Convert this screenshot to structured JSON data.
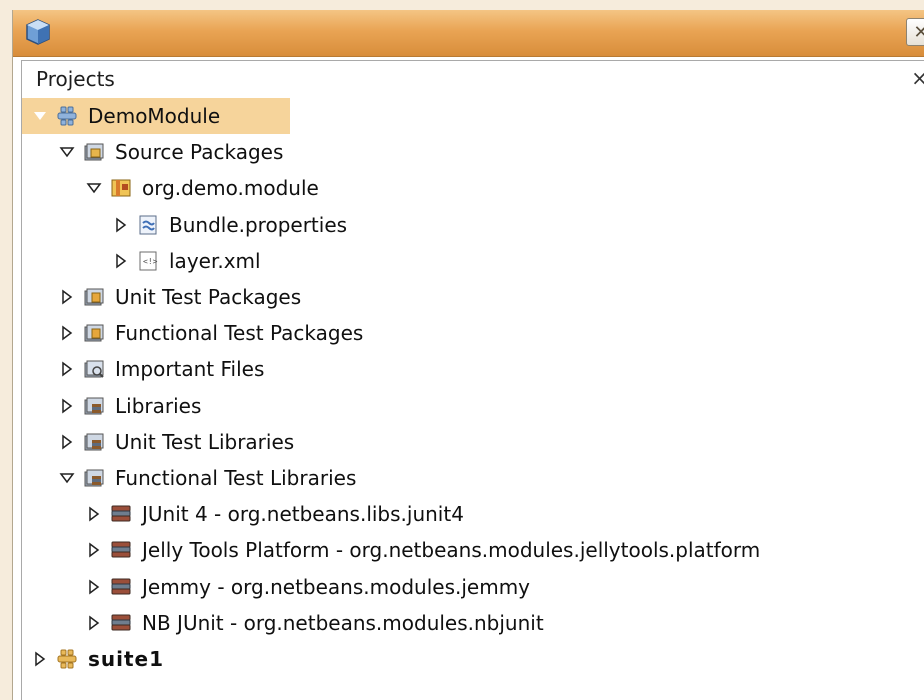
{
  "window": {
    "close_glyph": "✕"
  },
  "panel": {
    "title": "Projects",
    "close_glyph": "×"
  },
  "tree": [
    {
      "label": "DemoModule",
      "level": 0,
      "state": "expanded",
      "icon": "module-icon",
      "selected": true,
      "bold": false
    },
    {
      "label": "Source Packages",
      "level": 1,
      "state": "expanded",
      "icon": "source-packages-icon",
      "selected": false,
      "bold": false
    },
    {
      "label": "org.demo.module",
      "level": 2,
      "state": "expanded",
      "icon": "package-icon",
      "selected": false,
      "bold": false
    },
    {
      "label": "Bundle.properties",
      "level": 3,
      "state": "collapsed",
      "icon": "properties-file-icon",
      "selected": false,
      "bold": false
    },
    {
      "label": "layer.xml",
      "level": 3,
      "state": "collapsed",
      "icon": "xml-file-icon",
      "selected": false,
      "bold": false
    },
    {
      "label": "Unit Test Packages",
      "level": 1,
      "state": "collapsed",
      "icon": "test-packages-icon",
      "selected": false,
      "bold": false
    },
    {
      "label": "Functional Test Packages",
      "level": 1,
      "state": "collapsed",
      "icon": "test-packages-icon",
      "selected": false,
      "bold": false
    },
    {
      "label": "Important Files",
      "level": 1,
      "state": "collapsed",
      "icon": "important-files-icon",
      "selected": false,
      "bold": false
    },
    {
      "label": "Libraries",
      "level": 1,
      "state": "collapsed",
      "icon": "libraries-folder-icon",
      "selected": false,
      "bold": false
    },
    {
      "label": "Unit Test Libraries",
      "level": 1,
      "state": "collapsed",
      "icon": "libraries-folder-icon",
      "selected": false,
      "bold": false
    },
    {
      "label": "Functional Test Libraries",
      "level": 1,
      "state": "expanded",
      "icon": "libraries-folder-icon",
      "selected": false,
      "bold": false
    },
    {
      "label": "JUnit 4 - org.netbeans.libs.junit4",
      "level": 2,
      "state": "collapsed",
      "icon": "library-jar-icon",
      "selected": false,
      "bold": false
    },
    {
      "label": "Jelly Tools Platform - org.netbeans.modules.jellytools.platform",
      "level": 2,
      "state": "collapsed",
      "icon": "library-jar-icon",
      "selected": false,
      "bold": false
    },
    {
      "label": "Jemmy - org.netbeans.modules.jemmy",
      "level": 2,
      "state": "collapsed",
      "icon": "library-jar-icon",
      "selected": false,
      "bold": false
    },
    {
      "label": "NB JUnit - org.netbeans.modules.nbjunit",
      "level": 2,
      "state": "collapsed",
      "icon": "library-jar-icon",
      "selected": false,
      "bold": false
    },
    {
      "label": "suite1",
      "level": 0,
      "state": "collapsed",
      "icon": "suite-icon",
      "selected": false,
      "bold": true
    }
  ],
  "colors": {
    "titlebar": "#e9a454",
    "selection": "#f6d49b"
  }
}
